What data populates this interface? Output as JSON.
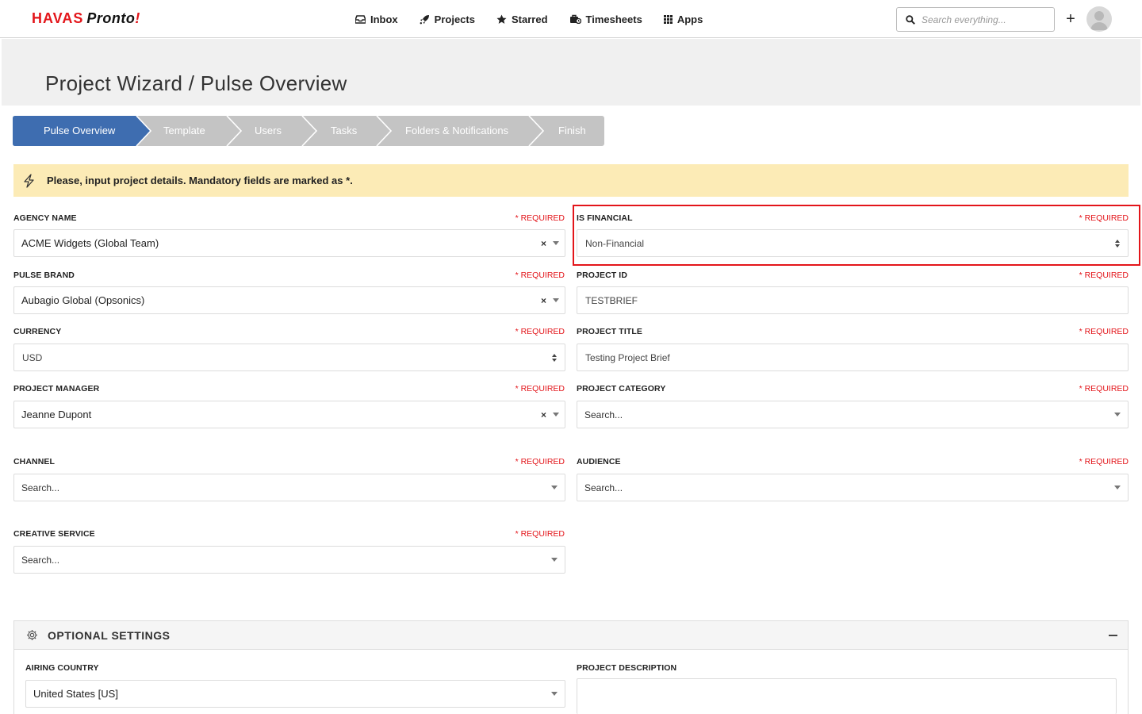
{
  "brand": {
    "havas": "HAVAS",
    "pronto": "Pronto",
    "bolt": "!"
  },
  "nav": {
    "items": [
      {
        "label": "Inbox",
        "icon": "inbox-icon"
      },
      {
        "label": "Projects",
        "icon": "rocket-icon"
      },
      {
        "label": "Starred",
        "icon": "star-icon"
      },
      {
        "label": "Timesheets",
        "icon": "timesheets-icon"
      },
      {
        "label": "Apps",
        "icon": "apps-grid-icon"
      }
    ]
  },
  "search": {
    "placeholder": "Search everything..."
  },
  "add_label": "+",
  "page_title": "Project Wizard / Pulse Overview",
  "steps": [
    "Pulse Overview",
    "Template",
    "Users",
    "Tasks",
    "Folders & Notifications",
    "Finish"
  ],
  "active_step": "Pulse Overview",
  "banner": {
    "text": "Please, input project details. Mandatory fields are marked as *."
  },
  "required_label": "* REQUIRED",
  "fields": {
    "agency_name": {
      "label": "AGENCY NAME",
      "value": "ACME Widgets (Global Team)"
    },
    "is_financial": {
      "label": "IS FINANCIAL",
      "value": "Non-Financial"
    },
    "pulse_brand": {
      "label": "PULSE BRAND",
      "value": "Aubagio Global (Opsonics)"
    },
    "project_id": {
      "label": "PROJECT ID",
      "value": "TESTBRIEF"
    },
    "currency": {
      "label": "CURRENCY",
      "value": "USD"
    },
    "project_title": {
      "label": "PROJECT TITLE",
      "value": "Testing Project Brief"
    },
    "project_manager": {
      "label": "PROJECT MANAGER",
      "value": "Jeanne Dupont"
    },
    "project_category": {
      "label": "PROJECT CATEGORY",
      "placeholder": "Search..."
    },
    "channel": {
      "label": "CHANNEL",
      "placeholder": "Search..."
    },
    "audience": {
      "label": "AUDIENCE",
      "placeholder": "Search..."
    },
    "creative_service": {
      "label": "CREATIVE SERVICE",
      "placeholder": "Search..."
    }
  },
  "clear_symbol": "×",
  "optional": {
    "title": "OPTIONAL SETTINGS",
    "airing_country": {
      "label": "AIRING COUNTRY",
      "value": "United States [US]"
    },
    "project_description": {
      "label": "PROJECT DESCRIPTION"
    }
  },
  "colors": {
    "brand_red": "#e3151a",
    "step_active": "#3e6db0",
    "step_inactive": "#c4c4c4",
    "banner_bg": "#fcebb6",
    "highlight": "#e3151a"
  }
}
